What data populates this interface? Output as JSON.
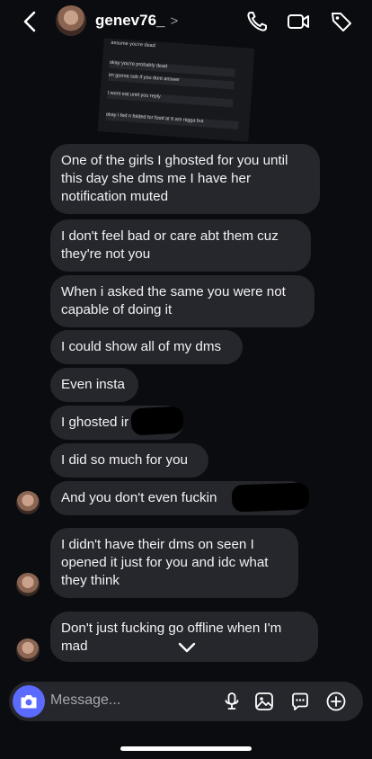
{
  "header": {
    "username": "genev76_",
    "chevron": ">",
    "icons": [
      "back-icon",
      "avatar",
      "phone-icon",
      "video-icon",
      "tag-icon"
    ]
  },
  "shared_screenshot": {
    "lines": [
      "assume you're dead",
      "okay you're probably dead",
      "im gonna sob if you dont answer",
      "I wont eat until you reply",
      "okay i fed n folded for food at 6 am nigga but"
    ]
  },
  "messages": [
    {
      "text": "One of the girls I ghosted for you until this day she dms me I have her notification muted"
    },
    {
      "text": "I don't feel bad or care abt them cuz they're not you"
    },
    {
      "text": "When i asked the same you were not capable of doing it"
    },
    {
      "text": "I could show all of my dms"
    },
    {
      "text": "Even insta"
    },
    {
      "text": "I ghosted ir"
    },
    {
      "text": "I did so much for you"
    },
    {
      "text": "And you don't even fuckin"
    },
    {
      "text": "I didn't have their dms on seen I opened it just for you and idc what they think"
    },
    {
      "text": "Don't just fucking go offline when I'm mad"
    }
  ],
  "composer": {
    "placeholder": "Message...",
    "icons": [
      "camera-icon",
      "microphone-icon",
      "gallery-icon",
      "sticker-icon",
      "add-icon"
    ]
  },
  "colors": {
    "background": "#0b0c10",
    "bubble": "#26272c",
    "camera_button": "#5c6bff"
  }
}
